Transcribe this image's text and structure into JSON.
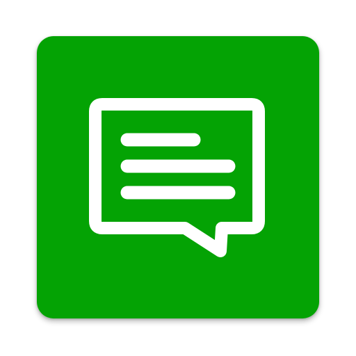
{
  "app_icon": {
    "icon": "message-icon",
    "colors": {
      "background": "#04A304",
      "glyph": "#ffffff"
    }
  }
}
